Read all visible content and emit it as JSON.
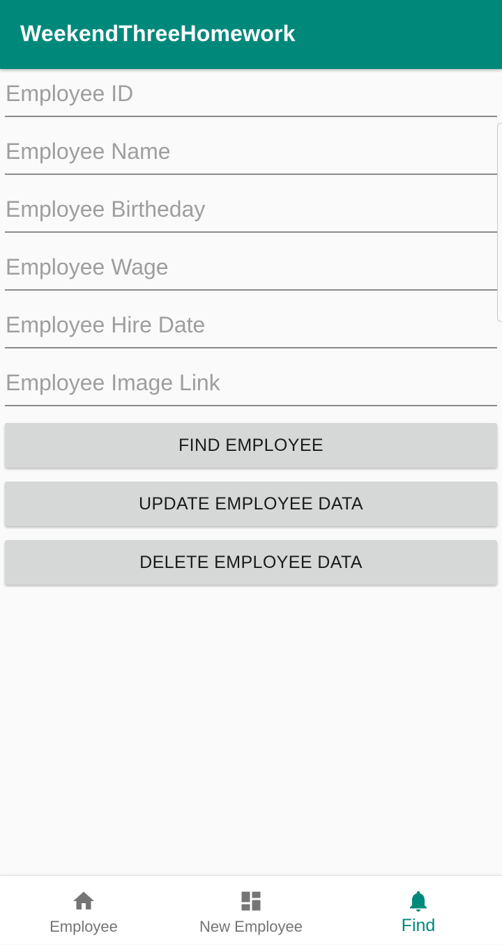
{
  "app_bar": {
    "title": "WeekendThreeHomework",
    "color": "#00897b"
  },
  "form": {
    "fields": [
      {
        "placeholder": "Employee ID",
        "value": ""
      },
      {
        "placeholder": "Employee Name",
        "value": ""
      },
      {
        "placeholder": "Employee Birtheday",
        "value": ""
      },
      {
        "placeholder": "Employee Wage",
        "value": ""
      },
      {
        "placeholder": "Employee Hire Date",
        "value": ""
      },
      {
        "placeholder": "Employee Image Link",
        "value": ""
      }
    ],
    "buttons": {
      "find": "FIND EMPLOYEE",
      "update": "UPDATE EMPLOYEE DATA",
      "delete": "DELETE EMPLOYEE DATA"
    }
  },
  "bottom_nav": {
    "active_color": "#00897b",
    "items": [
      {
        "label": "Employee",
        "icon": "home-icon",
        "active": false
      },
      {
        "label": "New Employee",
        "icon": "dashboard-icon",
        "active": false
      },
      {
        "label": "Find",
        "icon": "bell-icon",
        "active": true
      }
    ]
  }
}
